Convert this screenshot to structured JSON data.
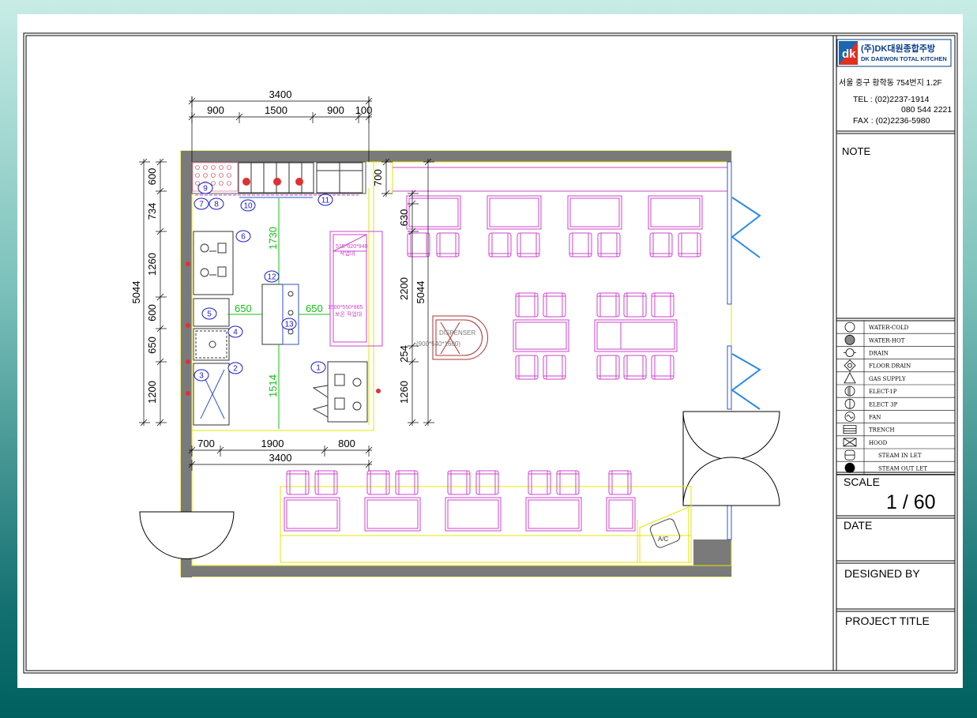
{
  "company": {
    "logo_mark": "dk",
    "name_kr": "(주)DK대원종합주방",
    "name_en": "DK DAEWON TOTAL KITCHEN",
    "address": "서울 중구 황학동 754번지 1.2F",
    "tel": "TEL : (02)2237-1914",
    "tel2": "080 544 2221",
    "fax": "FAX : (02)2236-5980"
  },
  "title_block": {
    "note_label": "NOTE",
    "scale_label": "SCALE",
    "scale_value": "1 / 60",
    "date_label": "DATE",
    "designed_by_label": "DESIGNED BY",
    "project_title_label": "PROJECT TITLE"
  },
  "legend": [
    {
      "icon": "water-cold-icon",
      "label": "WATER-COLD"
    },
    {
      "icon": "water-hot-icon",
      "label": "WATER-HOT"
    },
    {
      "icon": "drain-icon",
      "label": "DRAIN"
    },
    {
      "icon": "floor-drain-icon",
      "label": "FLOOR DRAIN"
    },
    {
      "icon": "gas-supply-icon",
      "label": "GAS SUPPLY"
    },
    {
      "icon": "elect-1p-icon",
      "label": "ELECT-1P"
    },
    {
      "icon": "elect-3p-icon",
      "label": "ELECT 3P"
    },
    {
      "icon": "fan-icon",
      "label": "FAN"
    },
    {
      "icon": "trench-icon",
      "label": "TRENCH"
    },
    {
      "icon": "hood-icon",
      "label": "HOOD"
    },
    {
      "icon": "steam-inlet-icon",
      "label": "STEAM IN LET"
    },
    {
      "icon": "steam-outlet-icon",
      "label": "STEAM OUT LET"
    }
  ],
  "dimensions": {
    "top_total": "3400",
    "top_segments": [
      "900",
      "1500",
      "900",
      "100"
    ],
    "bottom_segments": [
      "700",
      "1900",
      "800"
    ],
    "bottom_total": "3400",
    "left_total": "5044",
    "left_segments": [
      "600",
      "734",
      "1260",
      "600",
      "650",
      "1200"
    ],
    "right_total": "5044",
    "right_segments": [
      "700",
      "630",
      "2200",
      "254",
      "1260"
    ],
    "green_1730": "1730",
    "green_1514": "1514",
    "green_650_left": "650",
    "green_650_right": "650"
  },
  "plan_labels": {
    "table_spec": "515*620*940",
    "table_spec_sub": "작업대",
    "island_spec": "1500*550*865",
    "island_spec_sub": "보온 작업대",
    "dispenser": "DISPENSER",
    "dispenser_size": "(900*540*1600)",
    "ac": "A/C"
  },
  "equipment_numbers": [
    "1",
    "2",
    "3",
    "4",
    "5",
    "6",
    "7",
    "8",
    "9",
    "10",
    "11",
    "12",
    "13"
  ]
}
